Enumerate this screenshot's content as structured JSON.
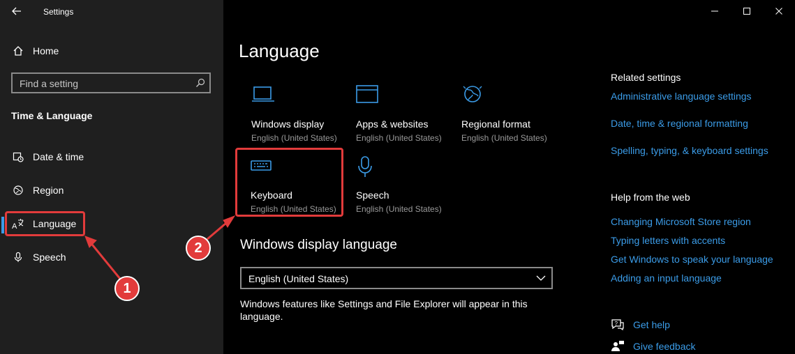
{
  "window": {
    "title": "Settings",
    "back_icon": "back-arrow-icon",
    "controls": [
      "minimize-icon",
      "maximize-icon",
      "close-icon"
    ]
  },
  "sidebar": {
    "home_label": "Home",
    "search_placeholder": "Find a setting",
    "section_title": "Time & Language",
    "items": [
      {
        "label": "Date & time",
        "icon": "clock-calendar-icon"
      },
      {
        "label": "Region",
        "icon": "globe-icon"
      },
      {
        "label": "Language",
        "icon": "language-icon",
        "active": true
      },
      {
        "label": "Speech",
        "icon": "microphone-icon"
      }
    ]
  },
  "main": {
    "page_title": "Language",
    "tiles": [
      {
        "title": "Windows display",
        "subtitle": "English (United States)",
        "icon": "laptop-icon"
      },
      {
        "title": "Apps & websites",
        "subtitle": "English (United States)",
        "icon": "app-window-icon"
      },
      {
        "title": "Regional format",
        "subtitle": "English (United States)",
        "icon": "regional-globe-icon"
      },
      {
        "title": "Keyboard",
        "subtitle": "English (United States)",
        "icon": "keyboard-icon"
      },
      {
        "title": "Speech",
        "subtitle": "English (United States)",
        "icon": "microphone-icon"
      }
    ],
    "display_language": {
      "heading": "Windows display language",
      "selected": "English (United States)",
      "description": "Windows features like Settings and File Explorer will appear in this language."
    }
  },
  "related": {
    "heading": "Related settings",
    "links": [
      "Administrative language settings",
      "Date, time & regional formatting",
      "Spelling, typing, & keyboard settings"
    ],
    "help_heading": "Help from the web",
    "help_links": [
      "Changing Microsoft Store region",
      "Typing letters with accents",
      "Get Windows to speak your language",
      "Adding an input language"
    ],
    "get_help": "Get help",
    "give_feedback": "Give feedback"
  },
  "annotations": {
    "badge_1": "1",
    "badge_2": "2",
    "color": "#e23b3b"
  },
  "colors": {
    "accent": "#3b9ce8",
    "sidebar_bg": "#1f1f1f",
    "main_bg": "#000000"
  }
}
